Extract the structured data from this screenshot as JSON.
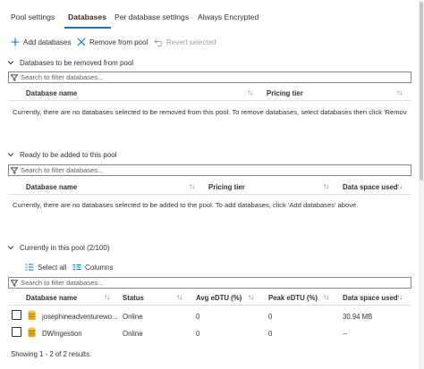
{
  "tabs": [
    {
      "label": "Pool settings"
    },
    {
      "label": "Databases"
    },
    {
      "label": "Per database settings"
    },
    {
      "label": "Always Encrypted"
    }
  ],
  "active_tab": "Databases",
  "commands": {
    "add": "Add databases",
    "remove": "Remove from pool",
    "revert": "Revert selected"
  },
  "sections": {
    "to_remove": {
      "title": "Databases to be removed from pool",
      "placeholder": "Search to filter databases...",
      "columns": {
        "name": "Database name",
        "pricing": "Pricing tier"
      },
      "empty_message": "Currently, there are no databases selected to be removed from this pool. To remove databases, select databases then click 'Remov"
    },
    "to_add": {
      "title": "Ready to be added to this pool",
      "placeholder": "Search to filter databases...",
      "columns": {
        "name": "Database name",
        "pricing": "Pricing tier",
        "space": "Data space used"
      },
      "empty_message": "Currently, there are no databases selected to be added to the pool. To add databases, click 'Add databases' above."
    },
    "current": {
      "title": "Currently in this pool (2/100)",
      "select_all": "Select all",
      "columns_label": "Columns",
      "placeholder": "Search to filter databases...",
      "columns": {
        "name": "Database name",
        "status": "Status",
        "avg": "Avg eDTU (%)",
        "peak": "Peak eDTU (%)",
        "space": "Data space used"
      },
      "rows": [
        {
          "name": "josephineadventurewo...",
          "status": "Online",
          "avg": "0",
          "peak": "0",
          "space": "30.94 MB"
        },
        {
          "name": "DWIngestion",
          "status": "Online",
          "avg": "0",
          "peak": "0",
          "space": "--"
        }
      ],
      "footer": "Showing 1 - 2 of 2 results."
    }
  },
  "colors": {
    "accent": "#0078d4",
    "db_icon": "#e8a317"
  }
}
